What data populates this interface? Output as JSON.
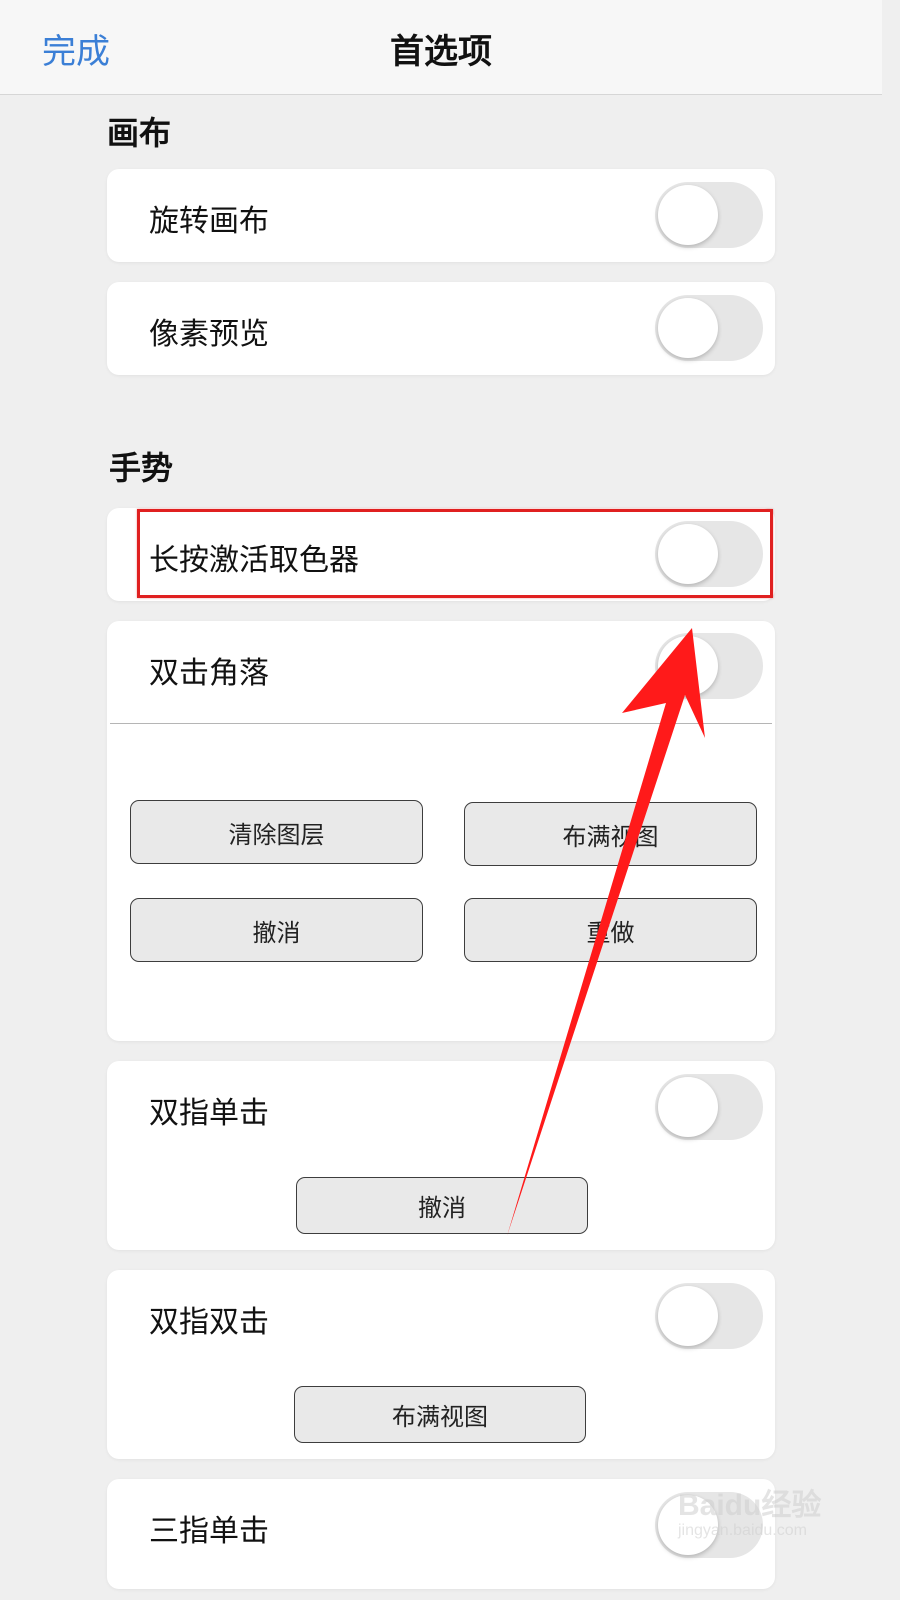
{
  "navbar": {
    "done_label": "完成",
    "title": "首选项",
    "accent_color": "#3b7fd6"
  },
  "sections": {
    "canvas": {
      "title": "画布",
      "rows": [
        {
          "label": "旋转画布",
          "toggle_on": false
        },
        {
          "label": "像素预览",
          "toggle_on": false
        }
      ]
    },
    "gestures": {
      "title": "手势",
      "long_press": {
        "label": "长按激活取色器",
        "toggle_on": false
      },
      "double_tap_corner": {
        "label": "双击角落",
        "toggle_on": false,
        "buttons": [
          "清除图层",
          "布满视图",
          "撤消",
          "重做"
        ]
      },
      "two_finger_tap": {
        "label": "双指单击",
        "toggle_on": false,
        "button": "撤消"
      },
      "two_finger_double_tap": {
        "label": "双指双击",
        "toggle_on": false,
        "button": "布满视图"
      },
      "three_finger_tap": {
        "label": "三指单击",
        "toggle_on": false
      }
    }
  },
  "annotation": {
    "highlight_color": "#e02020",
    "arrow_color": "#ff1a1a"
  },
  "watermark": {
    "brand": "Baidu经验",
    "url": "jingyan.baidu.com"
  }
}
